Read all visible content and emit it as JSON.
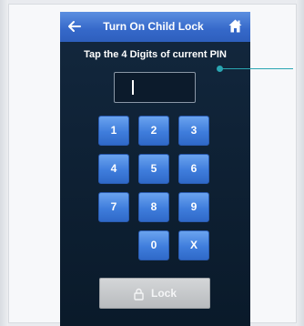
{
  "header": {
    "title": "Turn On Child Lock",
    "back_icon": "left-arrow-icon",
    "home_icon": "home-icon"
  },
  "instruction": "Tap the 4 Digits of current PIN",
  "pin_field": {
    "value": ""
  },
  "keypad": {
    "keys": [
      "1",
      "2",
      "3",
      "4",
      "5",
      "6",
      "7",
      "8",
      "9",
      "0",
      "X"
    ]
  },
  "lock_button": {
    "label": "Lock",
    "icon": "lock-icon"
  },
  "colors": {
    "header_blue": "#3568c9",
    "key_blue": "#3f7ddc",
    "background_navy": "#0f2236",
    "callout_teal": "#2aa6b2"
  }
}
